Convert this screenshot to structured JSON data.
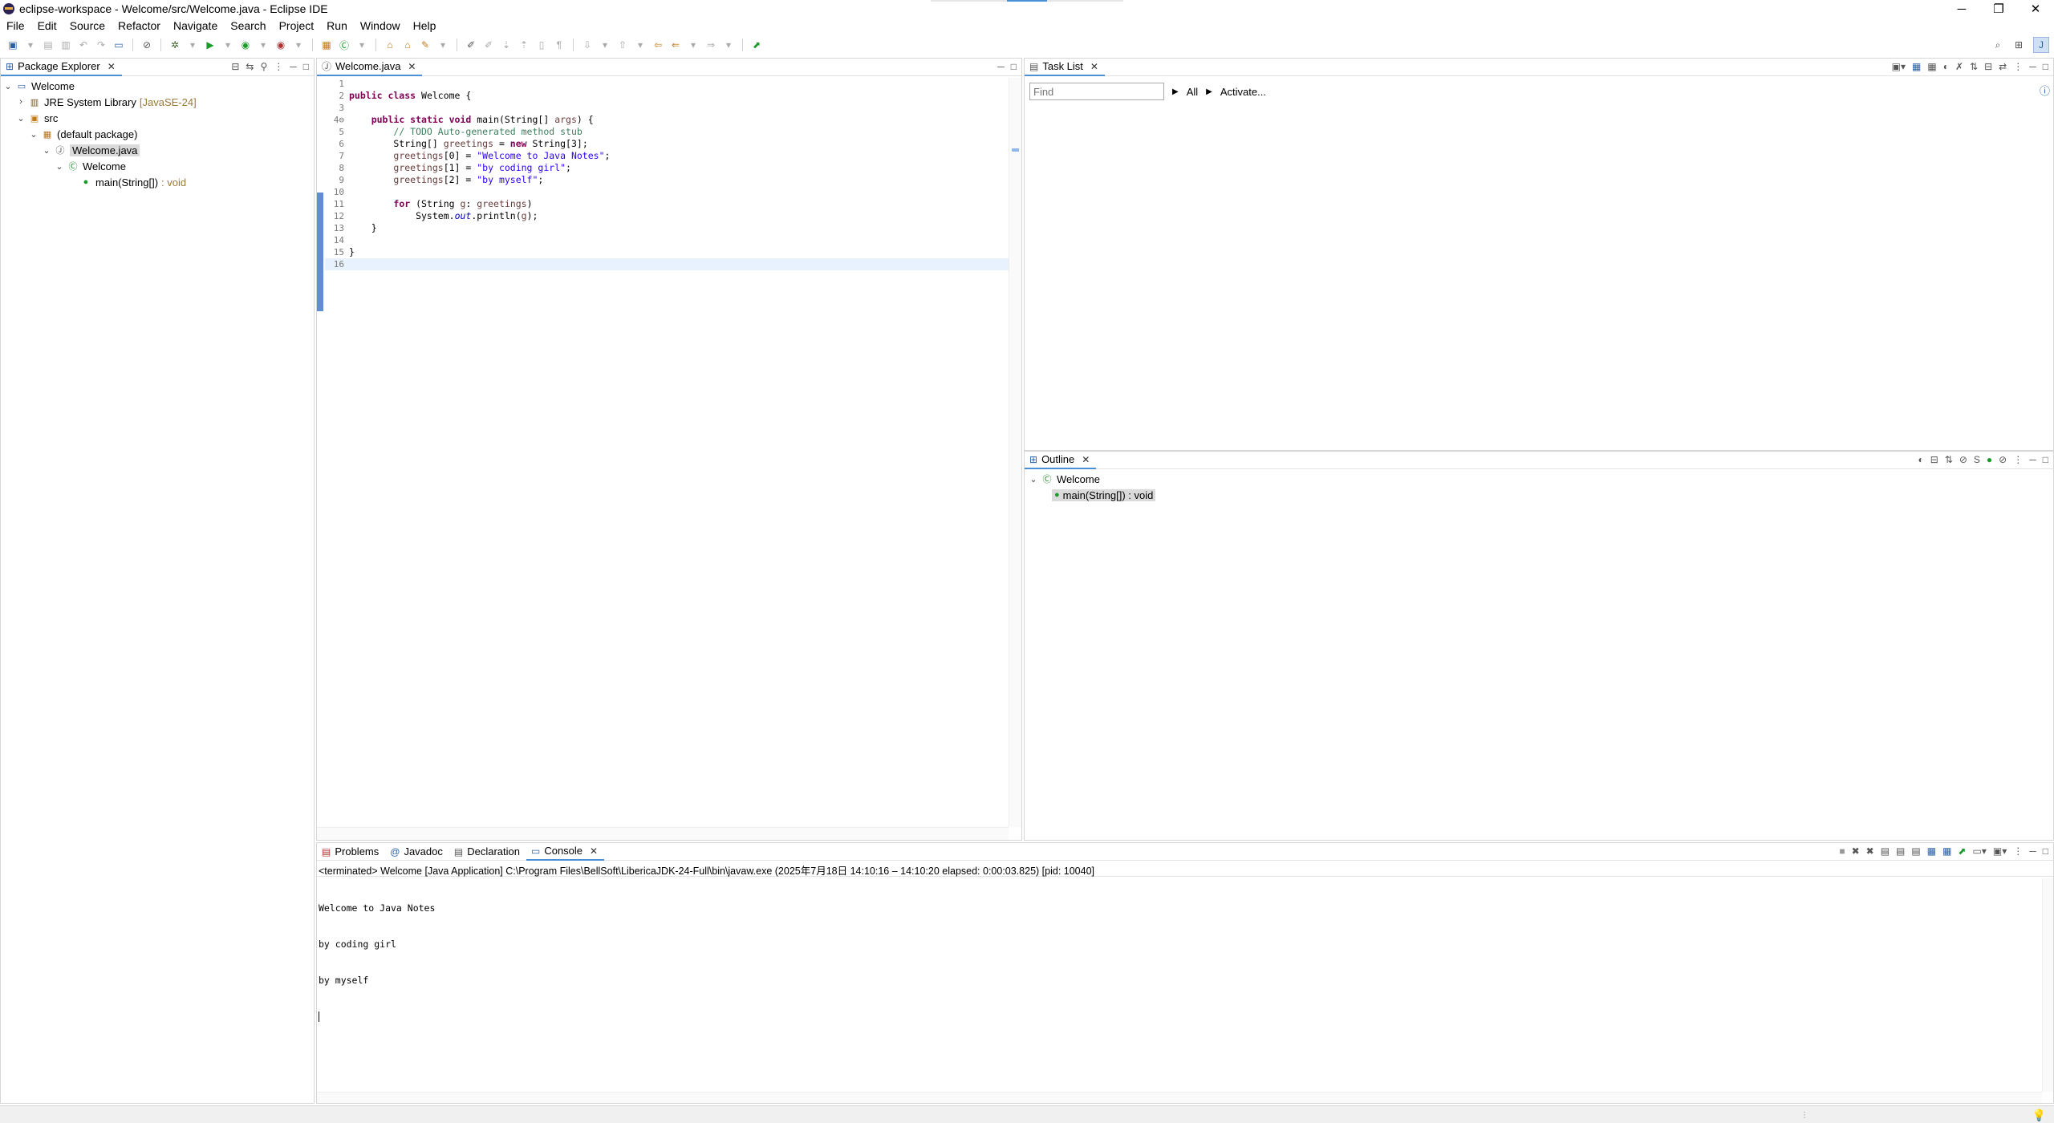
{
  "window": {
    "title": "eclipse-workspace - Welcome/src/Welcome.java - Eclipse IDE",
    "minimize": "─",
    "restore": "❐",
    "close": "✕"
  },
  "menu": [
    "File",
    "Edit",
    "Source",
    "Refactor",
    "Navigate",
    "Search",
    "Project",
    "Run",
    "Window",
    "Help"
  ],
  "package_explorer": {
    "tab_label": "Package Explorer",
    "tree": {
      "project": "Welcome",
      "jre": "JRE System Library",
      "jre_version": "[JavaSE-24]",
      "src": "src",
      "package": "(default package)",
      "file": "Welcome.java",
      "class": "Welcome",
      "method": "main(String[])",
      "method_type": ": void"
    }
  },
  "editor": {
    "tab_label": "Welcome.java",
    "lines": [
      {
        "n": "1",
        "html": ""
      },
      {
        "n": "2",
        "html": "<span class='kw'>public class</span> Welcome {"
      },
      {
        "n": "3",
        "html": ""
      },
      {
        "n": "4⊖",
        "html": "    <span class='kw'>public static void</span> main(String[] <span class='var'>args</span>) {"
      },
      {
        "n": "5",
        "html": "        <span class='cm'>// TODO Auto-generated method stub</span>"
      },
      {
        "n": "6",
        "html": "        String[] <span class='var'>greetings</span> = <span class='kw'>new</span> String[3];"
      },
      {
        "n": "7",
        "html": "        <span class='var'>greetings</span>[0] = <span class='str'>\"Welcome to Java Notes\"</span>;"
      },
      {
        "n": "8",
        "html": "        <span class='var'>greetings</span>[1] = <span class='str'>\"by coding girl\"</span>;"
      },
      {
        "n": "9",
        "html": "        <span class='var'>greetings</span>[2] = <span class='str'>\"by myself\"</span>;"
      },
      {
        "n": "10",
        "html": ""
      },
      {
        "n": "11",
        "html": "        <span class='kw'>for</span> (String <span class='var'>g</span>: <span class='var'>greetings</span>)"
      },
      {
        "n": "12",
        "html": "            System.<span class='fld'>out</span>.println(<span class='var'>g</span>);"
      },
      {
        "n": "13",
        "html": "    }"
      },
      {
        "n": "14",
        "html": ""
      },
      {
        "n": "15",
        "html": "}"
      },
      {
        "n": "16",
        "html": ""
      }
    ]
  },
  "task_list": {
    "tab_label": "Task List",
    "find_placeholder": "Find",
    "all_label": "All",
    "activate_label": "Activate..."
  },
  "outline": {
    "tab_label": "Outline",
    "class": "Welcome",
    "method": "main(String[]) : void"
  },
  "bottom_tabs": {
    "problems": "Problems",
    "javadoc": "Javadoc",
    "declaration": "Declaration",
    "console": "Console"
  },
  "console": {
    "header": "<terminated> Welcome [Java Application] C:\\Program Files\\BellSoft\\LibericaJDK-24-Full\\bin\\javaw.exe  (2025年7月18日 14:10:16 – 14:10:20 elapsed: 0:00:03.825) [pid: 10040]",
    "output": [
      "Welcome to Java Notes",
      "by coding girl",
      "by myself"
    ]
  },
  "colors": {
    "keyword": "#7f0055",
    "string": "#2a00ff",
    "comment": "#3f7f5f",
    "accent": "#4a90d9"
  }
}
